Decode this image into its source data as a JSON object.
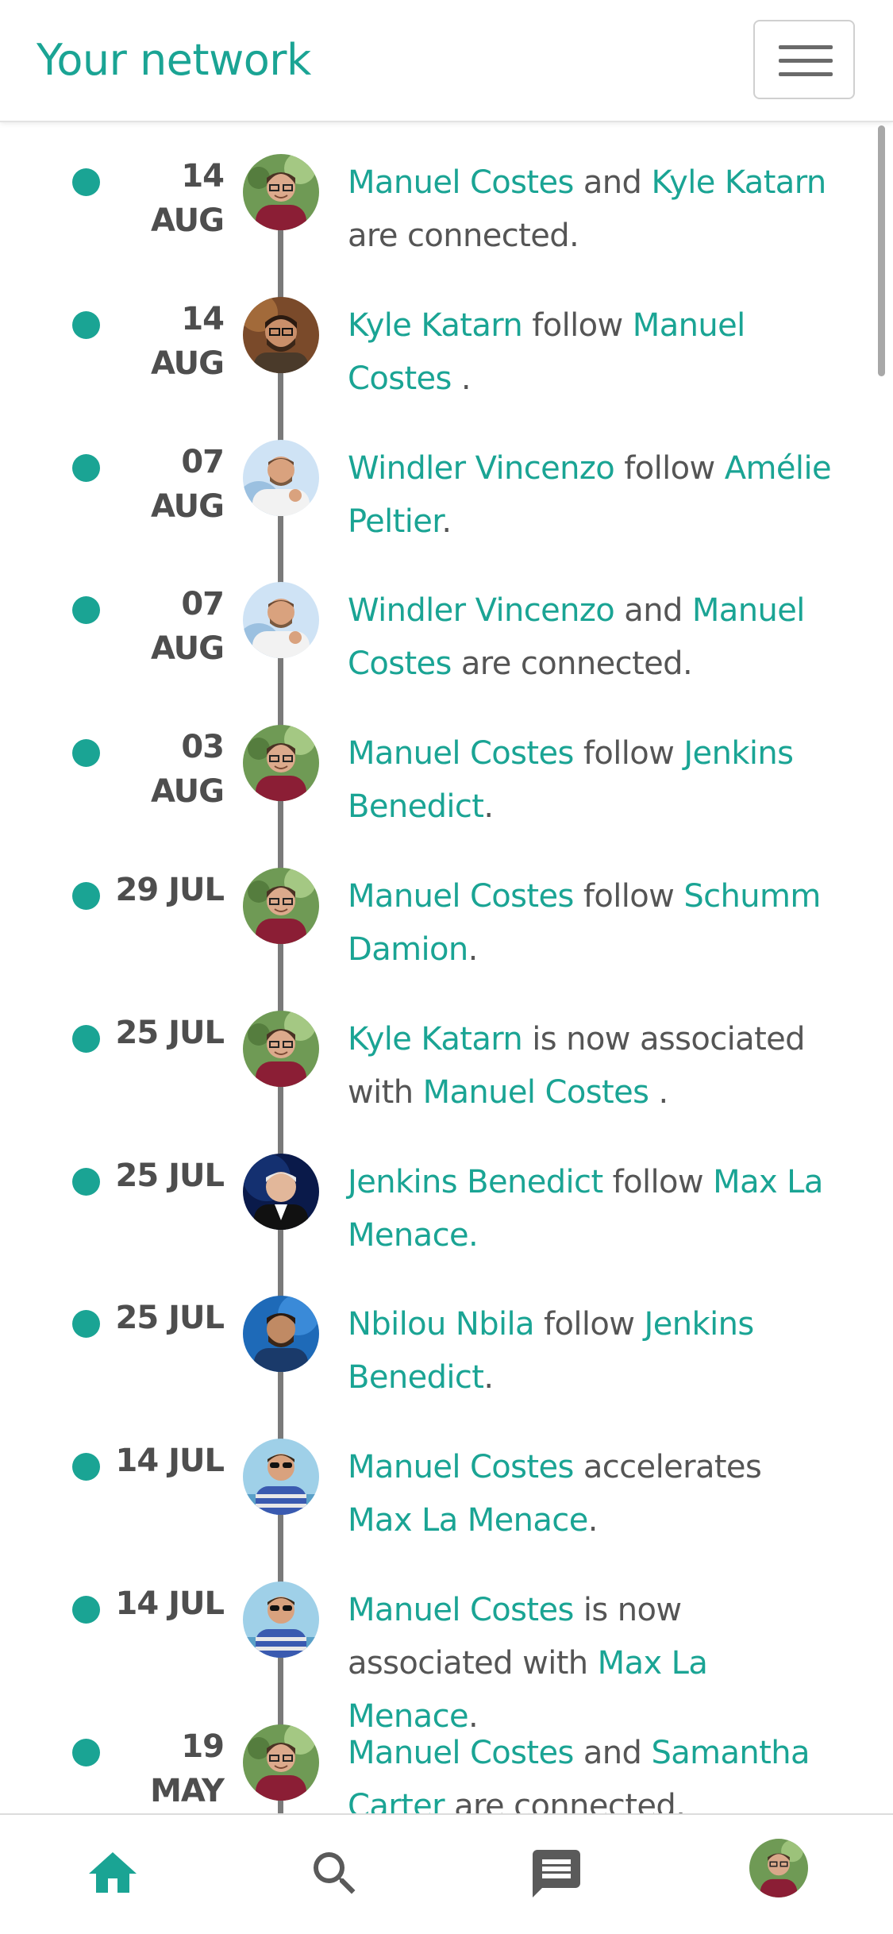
{
  "header": {
    "title": "Your network",
    "menu_icon": "hamburger-menu-icon"
  },
  "colors": {
    "accent": "#1aa494",
    "text": "#555555",
    "date": "#4e4e4e",
    "timeline": "#7a7a7a"
  },
  "feed": [
    {
      "date": "14 AUG",
      "avatar": "manuel-costes",
      "parts": [
        {
          "text": "Manuel Costes",
          "link": true
        },
        {
          "text": " and ",
          "link": false
        },
        {
          "text": "Kyle Katarn",
          "link": true
        },
        {
          "text": " are connected.",
          "link": false
        }
      ]
    },
    {
      "date": "14 AUG",
      "avatar": "kyle-katarn",
      "parts": [
        {
          "text": "Kyle Katarn",
          "link": true
        },
        {
          "text": " follow ",
          "link": false
        },
        {
          "text": "Manuel Costes",
          "link": true
        },
        {
          "text": " .",
          "link": false
        }
      ]
    },
    {
      "date": "07 AUG",
      "avatar": "windler-vincenzo",
      "parts": [
        {
          "text": "Windler Vincenzo",
          "link": true
        },
        {
          "text": " follow ",
          "link": false
        },
        {
          "text": "Amélie Peltier",
          "link": true
        },
        {
          "text": ".",
          "link": false
        }
      ]
    },
    {
      "date": "07 AUG",
      "avatar": "windler-vincenzo",
      "parts": [
        {
          "text": "Windler Vincenzo",
          "link": true
        },
        {
          "text": " and ",
          "link": false
        },
        {
          "text": "Manuel Costes",
          "link": true
        },
        {
          "text": " are connected.",
          "link": false
        }
      ]
    },
    {
      "date": "03 AUG",
      "avatar": "manuel-costes",
      "parts": [
        {
          "text": "Manuel Costes",
          "link": true
        },
        {
          "text": " follow ",
          "link": false
        },
        {
          "text": "Jenkins Benedict",
          "link": true
        },
        {
          "text": ".",
          "link": false
        }
      ]
    },
    {
      "date": "29 JUL",
      "avatar": "manuel-costes",
      "parts": [
        {
          "text": "Manuel Costes",
          "link": true
        },
        {
          "text": " follow ",
          "link": false
        },
        {
          "text": "Schumm Damion",
          "link": true
        },
        {
          "text": ".",
          "link": false
        }
      ]
    },
    {
      "date": "25 JUL",
      "avatar": "manuel-costes",
      "parts": [
        {
          "text": "Kyle Katarn",
          "link": true
        },
        {
          "text": " is now associated with ",
          "link": false
        },
        {
          "text": "Manuel Costes",
          "link": true
        },
        {
          "text": " .",
          "link": false
        }
      ]
    },
    {
      "date": "25 JUL",
      "avatar": "jenkins-benedict",
      "parts": [
        {
          "text": "Jenkins Benedict",
          "link": true
        },
        {
          "text": " follow ",
          "link": false
        },
        {
          "text": "Max La Menace",
          "link": true
        },
        {
          "text": ".",
          "link": true
        }
      ]
    },
    {
      "date": "25 JUL",
      "avatar": "nbilou-nbila",
      "parts": [
        {
          "text": "Nbilou Nbila",
          "link": true
        },
        {
          "text": " follow ",
          "link": false
        },
        {
          "text": "Jenkins Benedict",
          "link": true
        },
        {
          "text": ".",
          "link": false
        }
      ]
    },
    {
      "date": "14 JUL",
      "avatar": "max-la-menace",
      "parts": [
        {
          "text": "Manuel Costes",
          "link": true
        },
        {
          "text": " accelerates ",
          "link": false
        },
        {
          "text": "Max La Menace",
          "link": true
        },
        {
          "text": ".",
          "link": false
        }
      ]
    },
    {
      "date": "14 JUL",
      "avatar": "max-la-menace",
      "parts": [
        {
          "text": "Manuel Costes",
          "link": true
        },
        {
          "text": " is now associated with ",
          "link": false
        },
        {
          "text": "Max La Menace",
          "link": true
        },
        {
          "text": ".",
          "link": false
        }
      ]
    },
    {
      "date": "19 MAY",
      "avatar": "manuel-costes",
      "parts": [
        {
          "text": "Manuel Costes",
          "link": true
        },
        {
          "text": " and ",
          "link": false
        },
        {
          "text": "Samantha Carter",
          "link": true
        },
        {
          "text": " are connected.",
          "link": false
        }
      ]
    }
  ],
  "bottom_nav": [
    {
      "icon": "home-icon",
      "active": true
    },
    {
      "icon": "search-icon",
      "active": false
    },
    {
      "icon": "message-icon",
      "active": false
    },
    {
      "icon": "profile-avatar",
      "active": false
    }
  ]
}
